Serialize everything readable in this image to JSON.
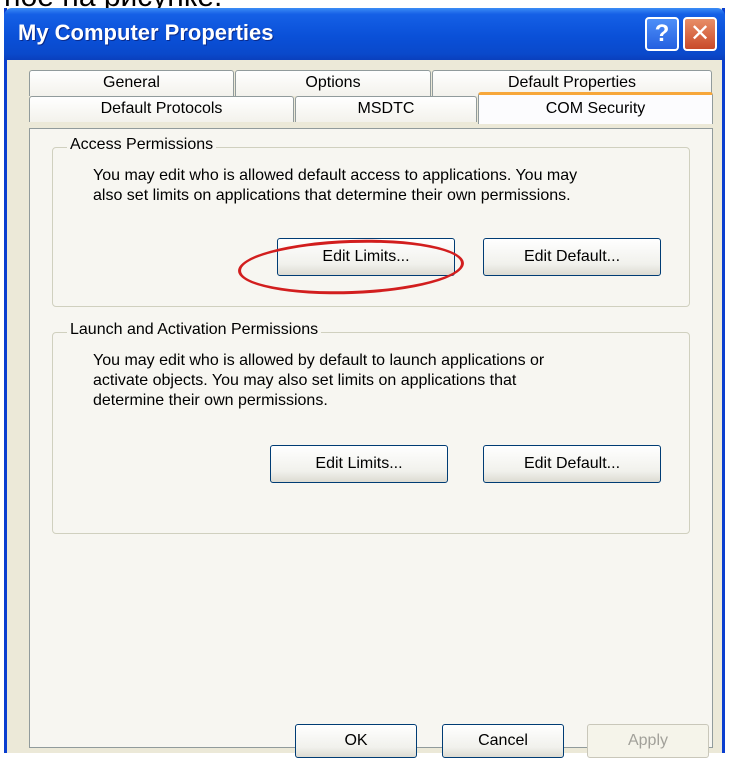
{
  "caption": "ное на рисунке.",
  "window": {
    "title": "My Computer Properties",
    "help_glyph": "?",
    "close_glyph": "✕"
  },
  "tabs": {
    "row1": [
      "General",
      "Options",
      "Default Properties"
    ],
    "row2": [
      "Default Protocols",
      "MSDTC",
      "COM Security"
    ],
    "selected": "COM Security"
  },
  "access_permissions": {
    "title": "Access Permissions",
    "description_line1": "You may edit who is allowed default access to applications. You may",
    "description_line2": "also set limits on applications that determine their own permissions.",
    "edit_limits_label": "Edit Limits...",
    "edit_default_label": "Edit Default..."
  },
  "launch_activation": {
    "title": "Launch and Activation Permissions",
    "description_line1": "You may edit who is allowed by default to launch applications or",
    "description_line2": "activate objects. You may also set limits on applications that",
    "description_line3": "determine their own permissions.",
    "edit_limits_label": "Edit Limits...",
    "edit_default_label": "Edit Default..."
  },
  "footer": {
    "ok_label": "OK",
    "cancel_label": "Cancel",
    "apply_label": "Apply"
  },
  "colors": {
    "titlebar": "#0a50d8",
    "dialog_bg": "#ece9d8",
    "selected_tab_accent": "#f7a73a",
    "highlight_ring": "#d21e1e"
  }
}
